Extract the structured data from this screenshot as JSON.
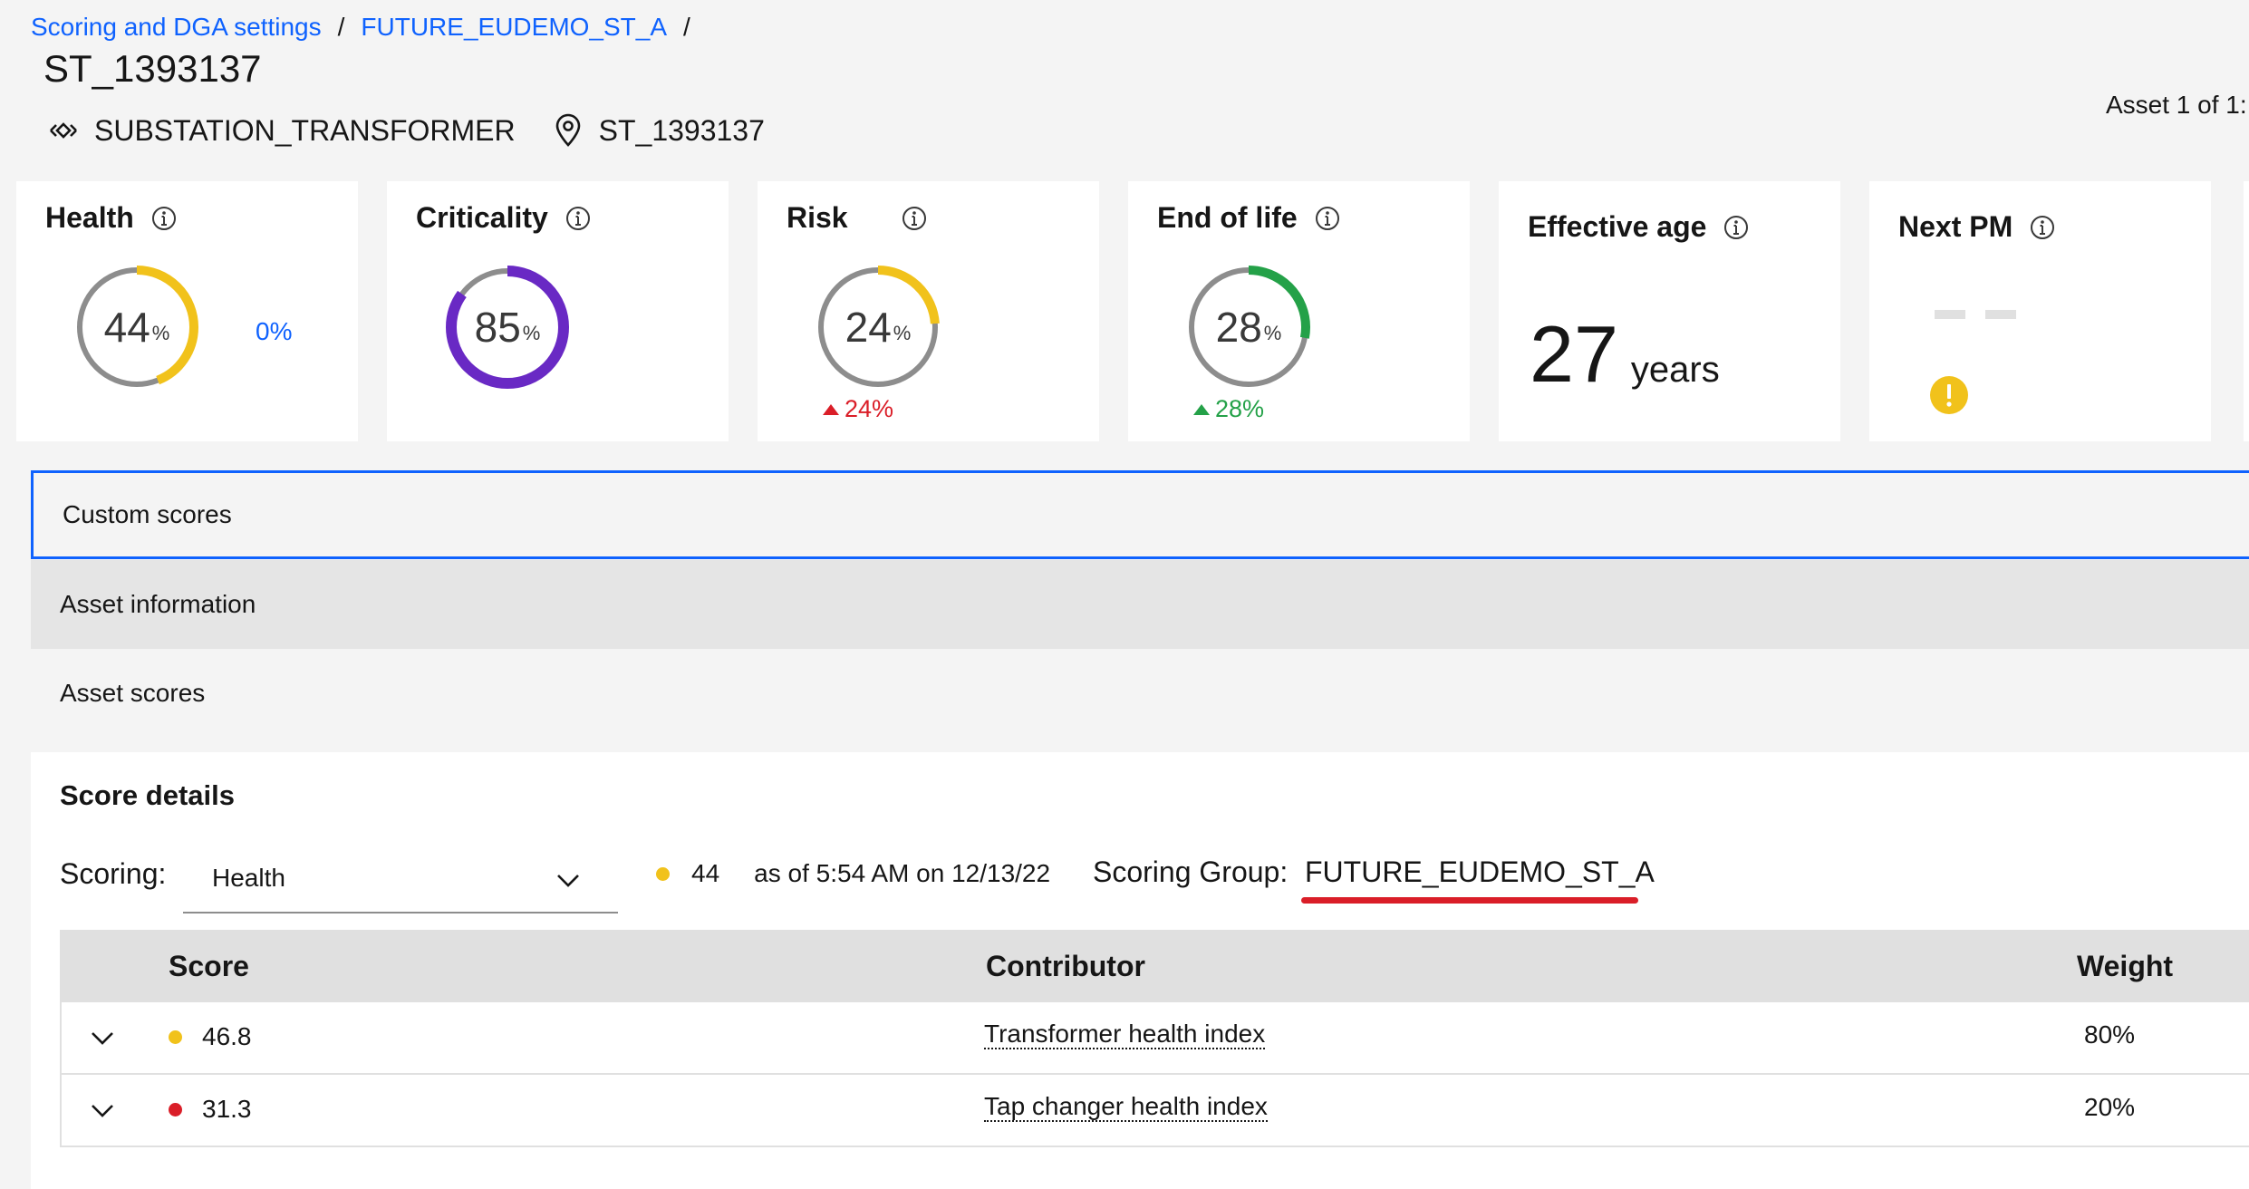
{
  "breadcrumb": [
    {
      "label": "Scoring and DGA settings"
    },
    {
      "label": "FUTURE_EUDEMO_ST_A"
    }
  ],
  "breadcrumb_separator": "/",
  "asset": {
    "title": "ST_1393137",
    "type": "SUBSTATION_TRANSFORMER",
    "location": "ST_1393137",
    "counter": "Asset 1 of 1:"
  },
  "cards": {
    "health": {
      "title": "Health",
      "value": "44",
      "unit": "%",
      "fill": 0.44,
      "color": "#f1c21b",
      "extra": "0%"
    },
    "criticality": {
      "title": "Criticality",
      "value": "85",
      "unit": "%",
      "fill": 0.85,
      "color": "#6929c4"
    },
    "risk": {
      "title": "Risk",
      "value": "24",
      "unit": "%",
      "fill": 0.24,
      "color": "#f1c21b",
      "delta": "24%",
      "delta_color": "#da1e28"
    },
    "end_of_life": {
      "title": "End of life",
      "value": "28",
      "unit": "%",
      "fill": 0.28,
      "color": "#24a148",
      "delta": "28%",
      "delta_color": "#24a148"
    },
    "effective_age": {
      "title": "Effective age",
      "value": "27",
      "unit": "years"
    },
    "next_pm": {
      "title": "Next PM",
      "value": "--",
      "icon": "warning-icon"
    }
  },
  "sections": {
    "custom_scores": "Custom scores",
    "asset_information": "Asset information",
    "asset_scores": "Asset scores"
  },
  "score_details": {
    "title": "Score details",
    "scoring_label": "Scoring:",
    "scoring_value": "Health",
    "current_score": "44",
    "current_score_color": "#f1c21b",
    "as_of": "as of 5:54 AM on 12/13/22",
    "group_label": "Scoring Group:",
    "group_value": "FUTURE_EUDEMO_ST_A"
  },
  "table": {
    "headers": {
      "score": "Score",
      "contributor": "Contributor",
      "weight": "Weight"
    },
    "rows": [
      {
        "score": "46.8",
        "dot": "yellow",
        "contributor": "Transformer health index",
        "weight": "80%"
      },
      {
        "score": "31.3",
        "dot": "red",
        "contributor": "Tap changer health index",
        "weight": "20%"
      }
    ]
  },
  "colors": {
    "link": "#0f62fe",
    "gauge_track": "#8d8d8d",
    "annotation_underline": "#da1e28"
  }
}
